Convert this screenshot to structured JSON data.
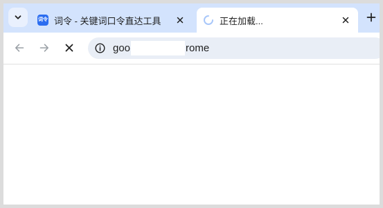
{
  "tabs": [
    {
      "title": "词令 - 关键词口令直达工具",
      "favicon_text": "词令",
      "state": "inactive"
    },
    {
      "title": "正在加载...",
      "state": "active-loading"
    }
  ],
  "icons": {
    "tab_search": "chevron-down-icon",
    "tab_close": "close-icon",
    "new_tab": "plus-icon",
    "back": "arrow-left-icon",
    "forward": "arrow-right-icon",
    "stop": "close-icon",
    "site_info": "info-icon",
    "loading": "spinner-icon"
  },
  "omnibox": {
    "url_start": "goo",
    "url_end": "rome"
  },
  "colors": {
    "tabstrip": "#d3e3fd",
    "omnibox": "#e9eef6",
    "favicon": "#2b6df0",
    "spinner": "#a8c7fa"
  }
}
